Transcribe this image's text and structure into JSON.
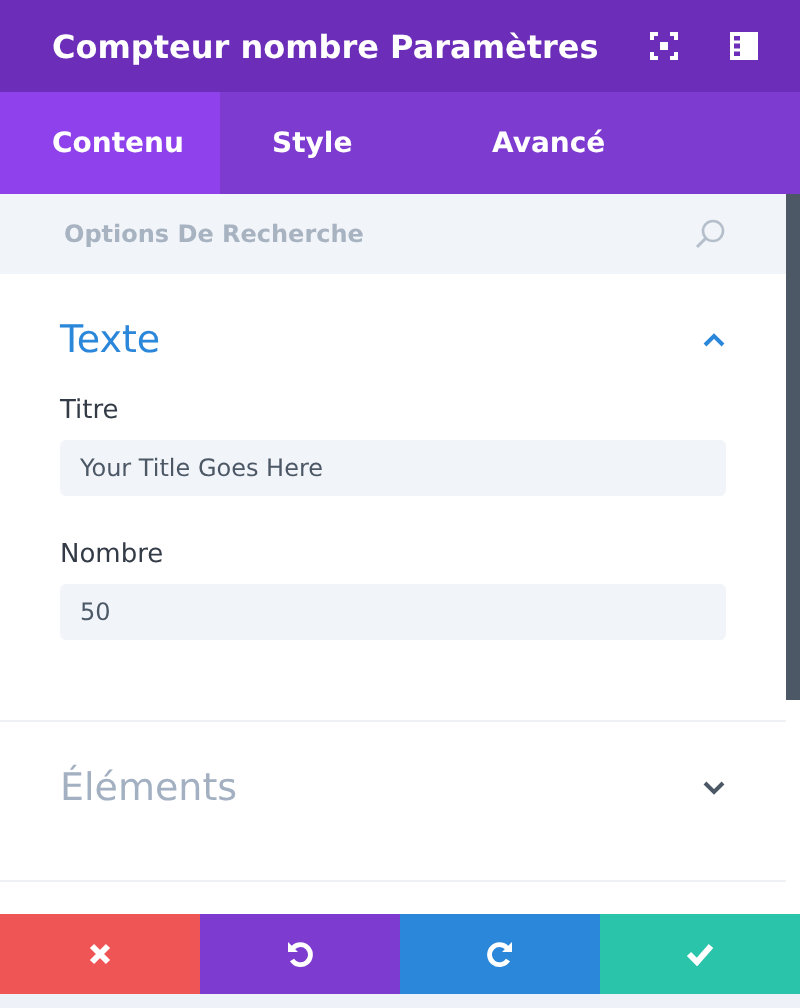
{
  "window": {
    "title": "Compteur nombre Paramètres"
  },
  "tabs": [
    {
      "label": "Contenu",
      "selected": true
    },
    {
      "label": "Style",
      "selected": false
    },
    {
      "label": "Avancé",
      "selected": false
    }
  ],
  "search": {
    "placeholder": "Options De Recherche"
  },
  "sections": [
    {
      "title": "Texte",
      "expanded": true,
      "fields": [
        {
          "label": "Titre",
          "placeholder": "Your Title Goes Here"
        },
        {
          "label": "Nombre",
          "value": "50"
        }
      ]
    },
    {
      "title": "Éléments",
      "expanded": false
    }
  ],
  "actions": [
    {
      "kind": "cancel"
    },
    {
      "kind": "undo"
    },
    {
      "kind": "redo"
    },
    {
      "kind": "save"
    }
  ]
}
